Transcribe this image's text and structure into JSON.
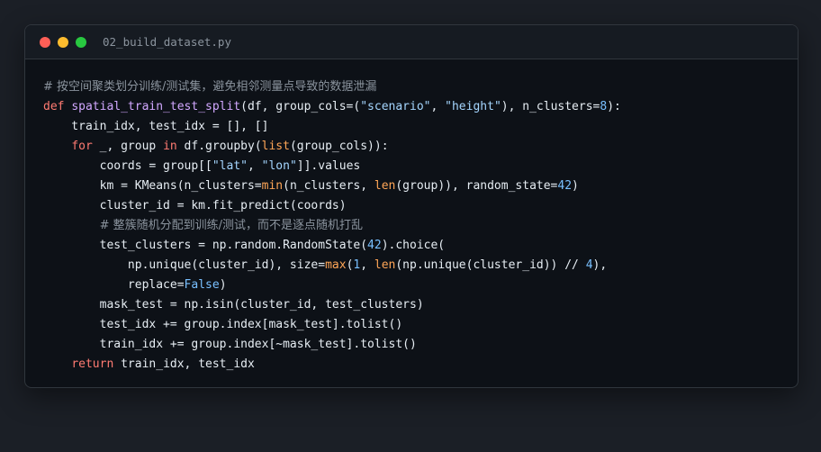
{
  "window": {
    "filename": "02_build_dataset.py"
  },
  "code_lines": [
    [
      [
        "cm",
        "# 按空间聚类划分训练/测试集，避免相邻测量点导致的数据泄漏"
      ]
    ],
    [
      [
        "kw",
        "def "
      ],
      [
        "fn",
        "spatial_train_test_split"
      ],
      [
        "pl",
        "(df, group_cols=("
      ],
      [
        "str",
        "\"scenario\""
      ],
      [
        "pl",
        ", "
      ],
      [
        "str",
        "\"height\""
      ],
      [
        "pl",
        "), n_clusters="
      ],
      [
        "num",
        "8"
      ],
      [
        "pl",
        "):"
      ]
    ],
    [
      [
        "pl",
        "    train_idx, test_idx = [], []"
      ]
    ],
    [
      [
        "pl",
        "    "
      ],
      [
        "kw",
        "for"
      ],
      [
        "pl",
        " _, group "
      ],
      [
        "kw",
        "in"
      ],
      [
        "pl",
        " df.groupby("
      ],
      [
        "bi",
        "list"
      ],
      [
        "pl",
        "(group_cols)):"
      ]
    ],
    [
      [
        "pl",
        "        coords = group[["
      ],
      [
        "str",
        "\"lat\""
      ],
      [
        "pl",
        ", "
      ],
      [
        "str",
        "\"lon\""
      ],
      [
        "pl",
        "]].values"
      ]
    ],
    [
      [
        "pl",
        "        km = KMeans(n_clusters="
      ],
      [
        "bi",
        "min"
      ],
      [
        "pl",
        "(n_clusters, "
      ],
      [
        "bi",
        "len"
      ],
      [
        "pl",
        "(group)), random_state="
      ],
      [
        "num",
        "42"
      ],
      [
        "pl",
        ")"
      ]
    ],
    [
      [
        "pl",
        "        cluster_id = km.fit_predict(coords)"
      ]
    ],
    [
      [
        "pl",
        "        "
      ],
      [
        "cm",
        "# 整簇随机分配到训练/测试，而不是逐点随机打乱"
      ]
    ],
    [
      [
        "pl",
        "        test_clusters = np.random.RandomState("
      ],
      [
        "num",
        "42"
      ],
      [
        "pl",
        ").choice("
      ]
    ],
    [
      [
        "pl",
        "            np.unique(cluster_id), size="
      ],
      [
        "bi",
        "max"
      ],
      [
        "pl",
        "("
      ],
      [
        "num",
        "1"
      ],
      [
        "pl",
        ", "
      ],
      [
        "bi",
        "len"
      ],
      [
        "pl",
        "(np.unique(cluster_id)) // "
      ],
      [
        "num",
        "4"
      ],
      [
        "pl",
        "),"
      ]
    ],
    [
      [
        "pl",
        "            replace="
      ],
      [
        "num",
        "False"
      ],
      [
        "pl",
        ")"
      ]
    ],
    [
      [
        "pl",
        "        mask_test = np.isin(cluster_id, test_clusters)"
      ]
    ],
    [
      [
        "pl",
        "        test_idx += group.index[mask_test].tolist()"
      ]
    ],
    [
      [
        "pl",
        "        train_idx += group.index[~mask_test].tolist()"
      ]
    ],
    [
      [
        "pl",
        "    "
      ],
      [
        "kw",
        "return"
      ],
      [
        "pl",
        " train_idx, test_idx"
      ]
    ]
  ]
}
